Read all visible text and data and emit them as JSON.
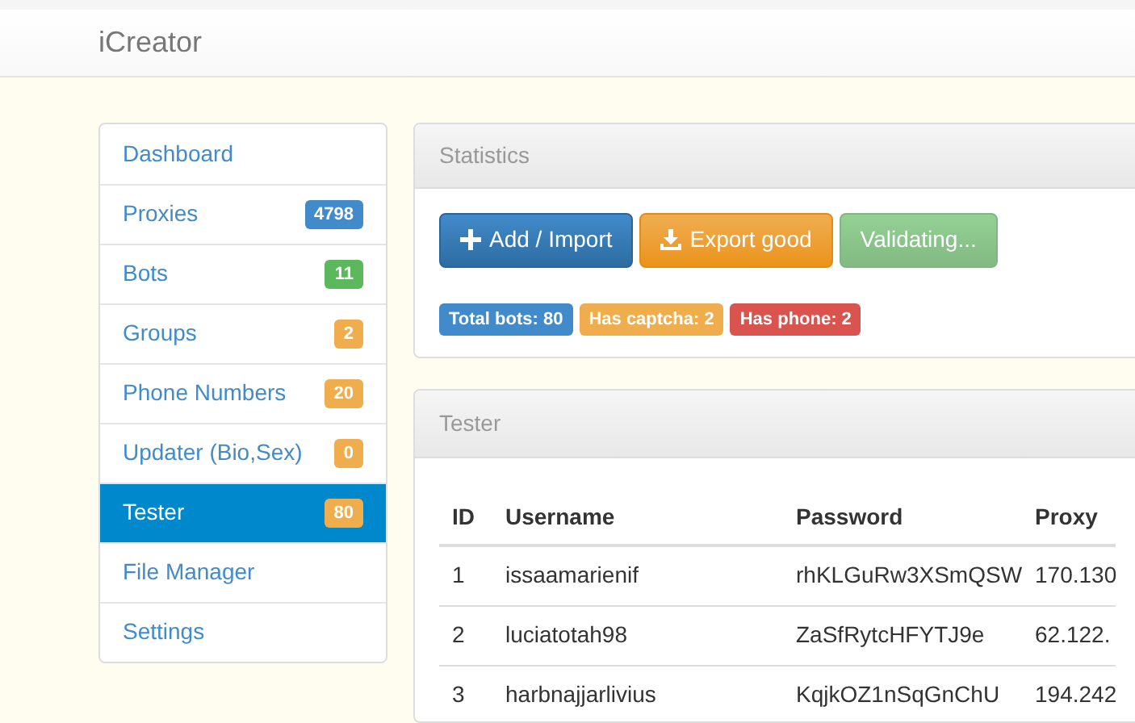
{
  "navbar": {
    "brand": "iCreator"
  },
  "sidebar": {
    "items": [
      {
        "label": "Dashboard",
        "selected": false
      },
      {
        "label": "Proxies",
        "selected": false,
        "badge": {
          "text": "4798",
          "kind": "primary"
        }
      },
      {
        "label": "Bots",
        "selected": false,
        "badge": {
          "text": "11",
          "kind": "success"
        }
      },
      {
        "label": "Groups",
        "selected": false,
        "badge": {
          "text": "2",
          "kind": "warning"
        }
      },
      {
        "label": "Phone Numbers",
        "selected": false,
        "badge": {
          "text": "20",
          "kind": "warning"
        }
      },
      {
        "label": "Updater (Bio,Sex)",
        "selected": false,
        "badge": {
          "text": "0",
          "kind": "warning"
        }
      },
      {
        "label": "Tester",
        "selected": true,
        "badge": {
          "text": "80",
          "kind": "warning"
        }
      },
      {
        "label": "File Manager",
        "selected": false
      },
      {
        "label": "Settings",
        "selected": false
      }
    ]
  },
  "statistics": {
    "title": "Statistics",
    "buttons": [
      {
        "label": "Add / Import",
        "kind": "primary",
        "disabled": false
      },
      {
        "label": "Export good",
        "kind": "warning",
        "disabled": false
      },
      {
        "label": "Validating...",
        "kind": "success",
        "disabled": true
      }
    ],
    "labels": [
      {
        "text": "Total bots: 80",
        "kind": "primary"
      },
      {
        "text": "Has captcha: 2",
        "kind": "warning"
      },
      {
        "text": "Has phone: 2",
        "kind": "danger"
      }
    ]
  },
  "tester": {
    "title": "Tester",
    "table": {
      "columns": [
        "ID",
        "Username",
        "Password",
        "Proxy"
      ],
      "rows": [
        [
          "1",
          "issaamarienif",
          "rhKLGuRw3XSmQSW",
          "170.130"
        ],
        [
          "2",
          "luciatotah98",
          "ZaSfRytcHFYTJ9e",
          "62.122."
        ],
        [
          "3",
          "harbnajjarlivius",
          "KqjkOZ1nSqGnChU",
          "194.242"
        ]
      ]
    }
  }
}
